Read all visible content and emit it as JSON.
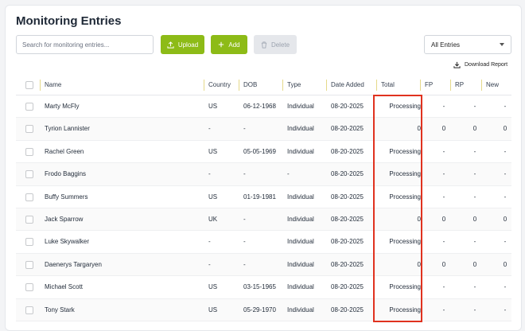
{
  "page": {
    "title": "Monitoring Entries"
  },
  "toolbar": {
    "search_placeholder": "Search for monitoring entries...",
    "upload_label": "Upload",
    "add_label": "Add",
    "delete_label": "Delete",
    "filter_value": "All Entries",
    "download_label": "Download Report"
  },
  "table": {
    "headers": {
      "name": "Name",
      "country": "Country",
      "dob": "DOB",
      "type": "Type",
      "date_added": "Date Added",
      "total": "Total",
      "fp": "FP",
      "rp": "RP",
      "new": "New"
    },
    "rows": [
      {
        "name": "Marty McFly",
        "country": "US",
        "dob": "06-12-1968",
        "type": "Individual",
        "date_added": "08-20-2025",
        "total": "Processing",
        "fp": "-",
        "rp": "-",
        "new": "-"
      },
      {
        "name": "Tyrion Lannister",
        "country": "-",
        "dob": "-",
        "type": "Individual",
        "date_added": "08-20-2025",
        "total": "0",
        "fp": "0",
        "rp": "0",
        "new": "0"
      },
      {
        "name": "Rachel Green",
        "country": "US",
        "dob": "05-05-1969",
        "type": "Individual",
        "date_added": "08-20-2025",
        "total": "Processing",
        "fp": "-",
        "rp": "-",
        "new": "-"
      },
      {
        "name": "Frodo Baggins",
        "country": "-",
        "dob": "-",
        "type": "-",
        "date_added": "08-20-2025",
        "total": "Processing",
        "fp": "-",
        "rp": "-",
        "new": "-"
      },
      {
        "name": "Buffy Summers",
        "country": "US",
        "dob": "01-19-1981",
        "type": "Individual",
        "date_added": "08-20-2025",
        "total": "Processing",
        "fp": "-",
        "rp": "-",
        "new": "-"
      },
      {
        "name": "Jack Sparrow",
        "country": "UK",
        "dob": "-",
        "type": "Individual",
        "date_added": "08-20-2025",
        "total": "0",
        "fp": "0",
        "rp": "0",
        "new": "0"
      },
      {
        "name": "Luke Skywalker",
        "country": "-",
        "dob": "-",
        "type": "Individual",
        "date_added": "08-20-2025",
        "total": "Processing",
        "fp": "-",
        "rp": "-",
        "new": "-"
      },
      {
        "name": "Daenerys Targaryen",
        "country": "-",
        "dob": "-",
        "type": "Individual",
        "date_added": "08-20-2025",
        "total": "0",
        "fp": "0",
        "rp": "0",
        "new": "0"
      },
      {
        "name": "Michael Scott",
        "country": "US",
        "dob": "03-15-1965",
        "type": "Individual",
        "date_added": "08-20-2025",
        "total": "Processing",
        "fp": "-",
        "rp": "-",
        "new": "-"
      },
      {
        "name": "Tony Stark",
        "country": "US",
        "dob": "05-29-1970",
        "type": "Individual",
        "date_added": "08-20-2025",
        "total": "Processing",
        "fp": "-",
        "rp": "-",
        "new": "-"
      }
    ]
  },
  "colors": {
    "accent": "#8dbb17",
    "highlight": "#e0321f",
    "disabled": "#e5e7eb"
  },
  "icons": {
    "upload": "upload-icon",
    "add": "plus-icon",
    "delete": "trash-icon",
    "download": "download-icon",
    "dropdown": "chevron-down-icon"
  }
}
